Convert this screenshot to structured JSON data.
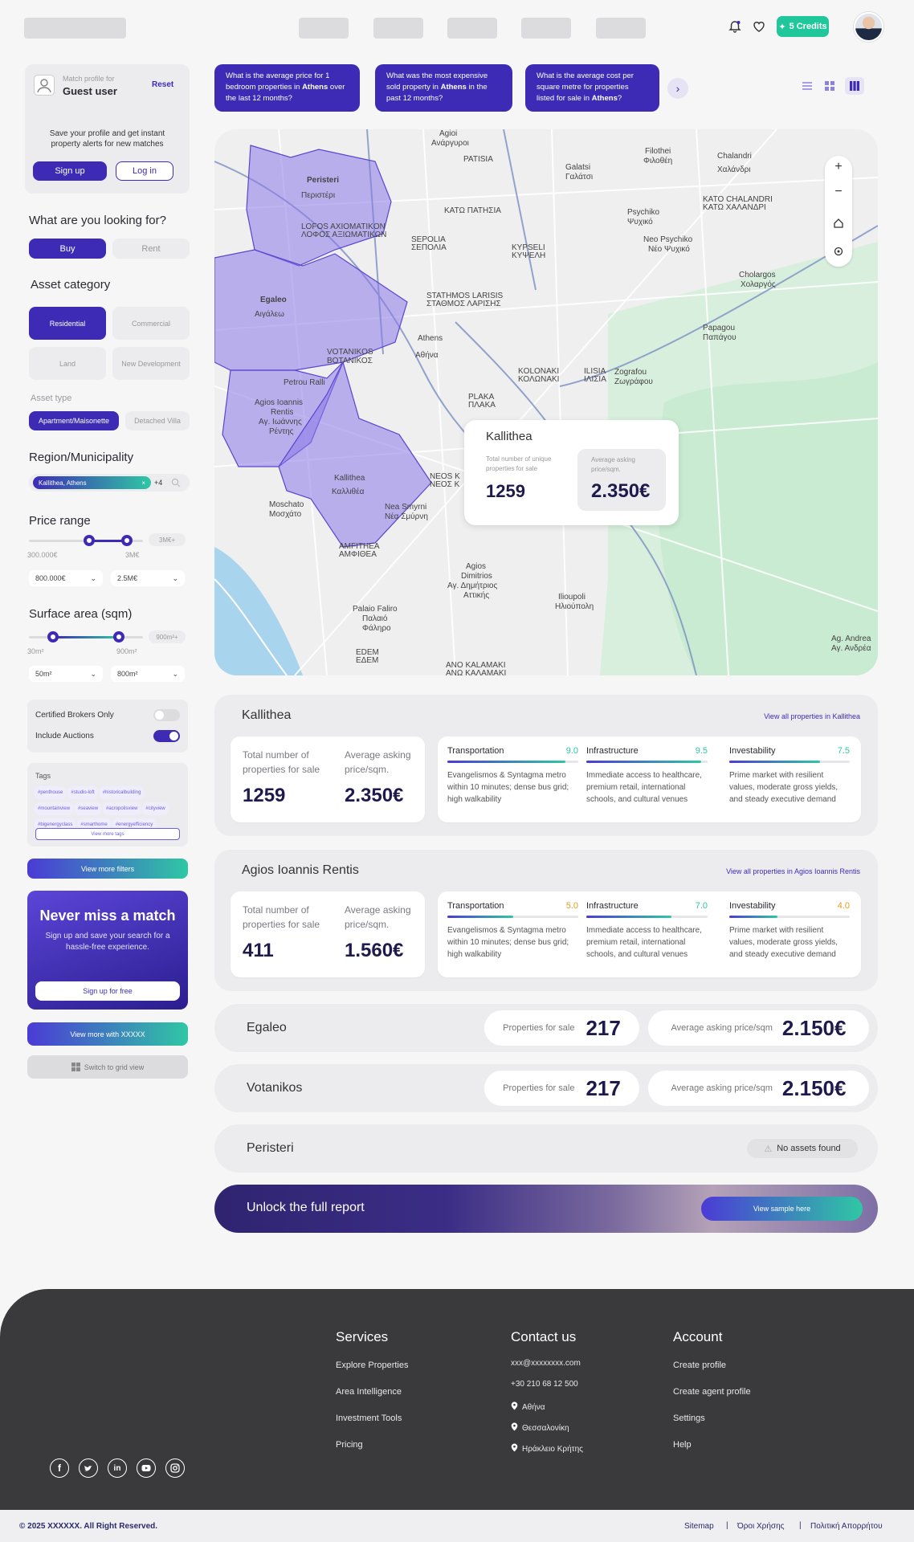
{
  "header": {
    "credits": "5 Credits"
  },
  "profile": {
    "match_label": "Match profile for",
    "user": "Guest user",
    "reset": "Reset",
    "desc": "Save your profile and get instant property alerts for new matches",
    "signup": "Sign up",
    "login": "Log in"
  },
  "filters": {
    "looking_title": "What are you looking for?",
    "buy": "Buy",
    "rent": "Rent",
    "asset_category_title": "Asset category",
    "cat_residential": "Residential",
    "cat_commercial": "Commercial",
    "cat_land": "Land",
    "cat_new": "New Development",
    "asset_type_title": "Asset type",
    "type_apartment": "Apartment/Maisonette",
    "type_villa": "Detached Villa",
    "region_title": "Region/Municipality",
    "region_value": "Kallithea, Athens",
    "region_more": "+4",
    "price_title": "Price range",
    "price_max_chip": "3M€+",
    "price_min_label": "300.000€",
    "price_max_label": "3M€",
    "price_min_sel": "800.000€",
    "price_max_sel": "2.5M€",
    "surface_title": "Surface area (sqm)",
    "surface_max_chip": "900m²+",
    "surface_min_label": "30m²",
    "surface_max_label": "900m²",
    "surface_min_sel": "50m²",
    "surface_max_sel": "800m²",
    "certified": "Certified Brokers Only",
    "auctions": "Include Auctions",
    "tags_title": "Tags",
    "tags": [
      "#penthouse",
      "#studio-loft",
      "#historicalbuilding",
      "#mountainview",
      "#seaview",
      "#acropolisview",
      "#cityview",
      "#bigenergyclass",
      "#smarthome",
      "#energyefficiency"
    ],
    "view_more_tags": "View more tags",
    "view_more_filters": "View more filters"
  },
  "promo": {
    "title": "Never miss a match",
    "text": "Sign up and save your search for a hassle-free experience.",
    "button": "Sign up for free"
  },
  "view_more_with": "View more with XXXXX",
  "switch_grid": "Switch to grid view",
  "questions": [
    {
      "pre": "What is the average price for 1 bedroom properties in ",
      "bold": "Athens",
      "post": " over the last 12 months?"
    },
    {
      "pre": "What was the most expensive sold property in ",
      "bold": "Athens",
      "post": " in the past 12 months?"
    },
    {
      "pre": "What is the average cost per square metre for properties listed for sale in ",
      "bold": "Athens",
      "post": "?"
    }
  ],
  "map": {
    "popup": {
      "title": "Kallithea",
      "total_label": "Total number of unique properties for sale",
      "total": "1259",
      "avg_label": "Average asking price/sqm.",
      "avg": "2.350€"
    },
    "labels": [
      "Peristeri",
      "Περιστέρι",
      "Egaleo",
      "Αιγάλεω",
      "Agios Ioannis",
      "Rentis",
      "Αγ. Ιωάννης",
      "Ρέντης",
      "Kallithea",
      "Καλλιθέα",
      "Athens",
      "Αθήνα",
      "Chalandri",
      "Χαλάνδρι",
      "Moschato",
      "Μοσχάτο",
      "Nea Smyrni",
      "Νέα Σμύρνη",
      "Agios",
      "Dimitrios",
      "Αγ. Δημήτριος",
      "Αττικής",
      "Palaio Faliro",
      "Παλαιό",
      "Φάληρο",
      "Ilioupoli",
      "Ηλιούπολη",
      "Psychiko",
      "Ψυχικό",
      "Neo Psychiko",
      "Νέο Ψυχικό",
      "Cholargos",
      "Χολαργός",
      "Papagou",
      "Παπάγου",
      "Zografou",
      "Ζωγράφου",
      "Filothei",
      "Φιλοθέη",
      "Galatsi",
      "Γαλάτσι",
      "VOTANIKOS",
      "ΒΟΤΑΝΙΚΟΣ",
      "Petrou Ralli",
      "PATISIA",
      "ΚΑΤΩ ΠΑΤΗΣΙΑ",
      "SEPOLIA",
      "ΣΕΠΟΛΙΑ",
      "KYPSELI",
      "ΚΥΨΕΛΗ",
      "KOLONAKI",
      "ΚΟΛΩΝΑΚΙ",
      "ILISIA",
      "ΙΛΙΣΙΑ",
      "PLAKA",
      "ΠΛΑΚΑ",
      "Ag. Andrea",
      "Αγ. Ανδρέα",
      "AMFITHEA",
      "ΑΜΦΙΘΕΑ",
      "ANO KALAMAKI",
      "ΑΝΩ ΚΑΛΑΜΑΚΙ",
      "EDEM",
      "ΕΔΕΜ",
      "NEOS K",
      "ΝΕΟΣ Κ",
      "Agioi",
      "Ανάργυροι",
      "LOFOS AXIOMATIKON",
      "ΛΟΦΟΣ ΑΞΙΩΜΑΤΙΚΩΝ",
      "KATO CHALANDRI",
      "ΚΑΤΩ ΧΑΛΑΝΔΡΙ",
      "STATHMOS LARISIS",
      "ΣΤΑΘΜΟΣ ΛΑΡΙΣΗΣ"
    ]
  },
  "regions": [
    {
      "name": "Kallithea",
      "link": "View all properties in Kallithea",
      "total_label": "Total number of properties for sale",
      "total": "1259",
      "avg_label": "Average asking price/sqm.",
      "avg": "2.350€",
      "scores": [
        {
          "name": "Transportation",
          "score": "9.0",
          "value": 9.0,
          "text": "Evangelismos & Syntagma metro within 10 minutes; dense bus grid; high walkability"
        },
        {
          "name": "Infrastructure",
          "score": "9.5",
          "value": 9.5,
          "text": "Immediate access to healthcare, premium retail, international schools, and cultural venues"
        },
        {
          "name": "Investability",
          "score": "7.5",
          "value": 7.5,
          "text": "Prime market with resilient values, moderate gross yields, and steady executive demand"
        }
      ]
    },
    {
      "name": "Agios Ioannis Rentis",
      "link": "View all properties in Agios Ioannis Rentis",
      "total_label": "Total number of properties for sale",
      "total": "411",
      "avg_label": "Average asking price/sqm.",
      "avg": "1.560€",
      "scores": [
        {
          "name": "Transportation",
          "score": "5.0",
          "value": 5.0,
          "text": "Evangelismos & Syntagma metro within 10 minutes; dense bus grid; high walkability"
        },
        {
          "name": "Infrastructure",
          "score": "7.0",
          "value": 7.0,
          "text": "Immediate access to healthcare, premium retail, international schools, and cultural venues"
        },
        {
          "name": "Investability",
          "score": "4.0",
          "value": 4.0,
          "text": "Prime market with resilient values, moderate gross yields, and steady executive demand"
        }
      ]
    }
  ],
  "compact": [
    {
      "name": "Egaleo",
      "props_label": "Properties for sale",
      "props": "217",
      "avg_label": "Average asking price/sqm",
      "avg": "2.150€"
    },
    {
      "name": "Votanikos",
      "props_label": "Properties for sale",
      "props": "217",
      "avg_label": "Average asking price/sqm",
      "avg": "2.150€"
    }
  ],
  "peristeri": {
    "name": "Peristeri",
    "no_assets": "No assets found"
  },
  "unlock": {
    "title": "Unlock the full report",
    "button": "View sample here"
  },
  "footer": {
    "services_title": "Services",
    "services": [
      "Explore Properties",
      "Area Intelligence",
      "Investment Tools",
      "Pricing"
    ],
    "contact_title": "Contact us",
    "email": "xxx@xxxxxxxx.com",
    "phone": "+30 210 68 12 500",
    "locations": [
      "Αθήνα",
      "Θεσσαλονίκη",
      "Ηράκλειο Κρήτης"
    ],
    "account_title": "Account",
    "account": [
      "Create profile",
      "Create agent profile",
      "Settings",
      "Help"
    ],
    "copyright": "© 2025 XXXXXX. All Right Reserved.",
    "sitemap": "Sitemap",
    "terms": "Όροι Χρήσης",
    "privacy": "Πολιτική Απορρήτου"
  },
  "colors": {
    "primary": "#3d2bb5",
    "accent": "#2fc7a4",
    "footer": "#3a3a3c"
  }
}
